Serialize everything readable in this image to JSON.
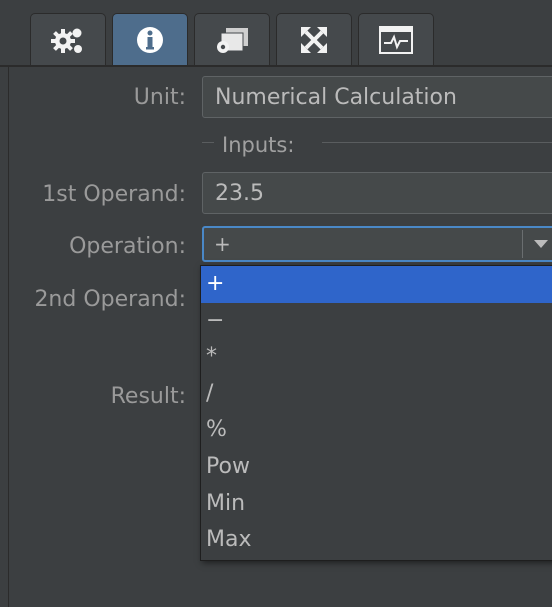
{
  "tabs": [
    {
      "icon": "gears-icon",
      "active": false
    },
    {
      "icon": "info-icon",
      "active": true
    },
    {
      "icon": "windows-gear-icon",
      "active": false
    },
    {
      "icon": "expand-arrows-icon",
      "active": false
    },
    {
      "icon": "waveform-monitor-icon",
      "active": false
    }
  ],
  "form": {
    "unit_label": "Unit:",
    "unit_value": "Numerical Calculation",
    "inputs_title": "Inputs:",
    "operand1_label": "1st Operand:",
    "operand1_value": "23.5",
    "operation_label": "Operation:",
    "operation_value": "+",
    "operand2_label": "2nd Operand:",
    "result_label": "Result:"
  },
  "operation_options": [
    "+",
    "−",
    "*",
    "/",
    "%",
    "Pow",
    "Min",
    "Max"
  ],
  "selected_option_index": 0,
  "colors": {
    "background": "#3c3f41",
    "active_tab": "#4e6d8c",
    "selection": "#2f65ca",
    "focus_border": "#4a88c7"
  }
}
